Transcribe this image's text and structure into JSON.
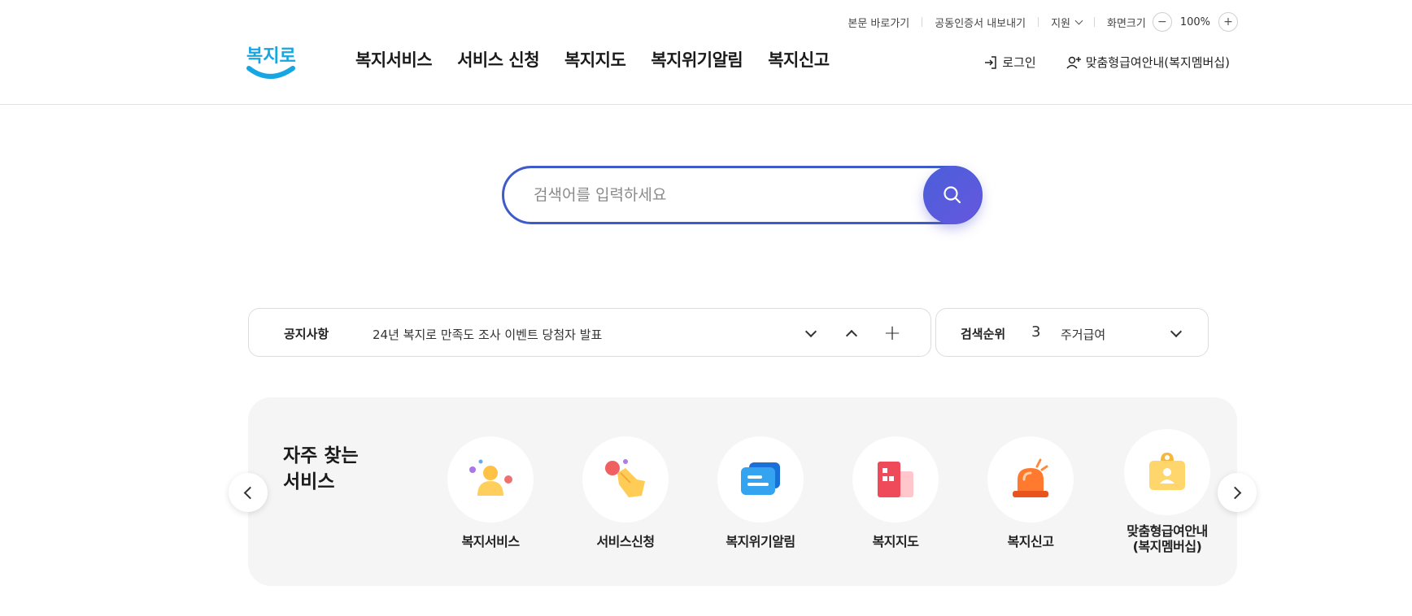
{
  "util_links": {
    "skip": "본문 바로가기",
    "cert": "공동인증서 내보내기",
    "support": "지원",
    "zoom_label": "화면크기",
    "zoom_minus": "−",
    "zoom_value": "100%",
    "zoom_plus": "+"
  },
  "logo": {
    "text": "복지로"
  },
  "gnb": [
    "복지서비스",
    "서비스 신청",
    "복지지도",
    "복지위기알림",
    "복지신고"
  ],
  "member": {
    "login": "로그인",
    "membership": "맞춤형급여안내(복지멤버십)"
  },
  "search": {
    "placeholder": "검색어를 입력하세요"
  },
  "notice": {
    "label": "공지사항",
    "text": "24년 복지로 만족도 조사 이벤트 당첨자 발표",
    "plus": "+"
  },
  "ranking": {
    "label": "검색순위",
    "rank": "3",
    "term": "주거급여"
  },
  "frequent": {
    "title": "자주 찾는\n서비스",
    "items": [
      {
        "label": "복지서비스",
        "icon": "person-icon"
      },
      {
        "label": "서비스신청",
        "icon": "hand-tap-icon"
      },
      {
        "label": "복지위기알림",
        "icon": "chat-icon"
      },
      {
        "label": "복지지도",
        "icon": "building-icon"
      },
      {
        "label": "복지신고",
        "icon": "siren-icon"
      },
      {
        "label": "맞춤형급여안내\n(복지멤버십)",
        "icon": "id-card-icon"
      }
    ]
  },
  "colors": {
    "accent": "#3f5bc9",
    "logo_blue": "#16a7e3",
    "panel_bg": "#f5f5f5"
  }
}
